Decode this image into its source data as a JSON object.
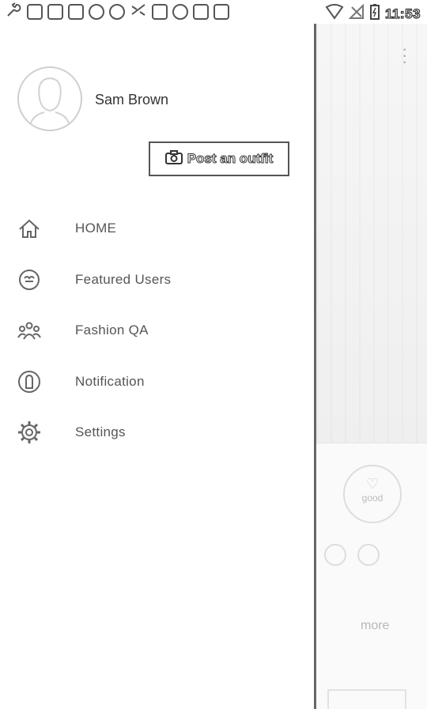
{
  "status_bar": {
    "time": "11:53",
    "icons": [
      "wrench-icon",
      "image-icon",
      "image-icon",
      "chat-icon",
      "speech-icon",
      "circle-icon",
      "shuffle-icon",
      "lock-icon",
      "android-icon",
      "clipboard-icon",
      "briefcase-icon",
      "wifi-icon",
      "no-signal-icon",
      "battery-icon"
    ]
  },
  "drawer": {
    "user": {
      "name": "Sam Brown"
    },
    "post_button_label": "Post an outfit",
    "menu": [
      {
        "label": "HOME",
        "icon": "home-icon"
      },
      {
        "label": "Featured Users",
        "icon": "featured-users-icon"
      },
      {
        "label": "Fashion QA",
        "icon": "group-icon"
      },
      {
        "label": "Notification",
        "icon": "notification-icon"
      },
      {
        "label": "Settings",
        "icon": "gear-icon"
      }
    ]
  },
  "background_app": {
    "good_label": "good",
    "more_label": "more"
  }
}
